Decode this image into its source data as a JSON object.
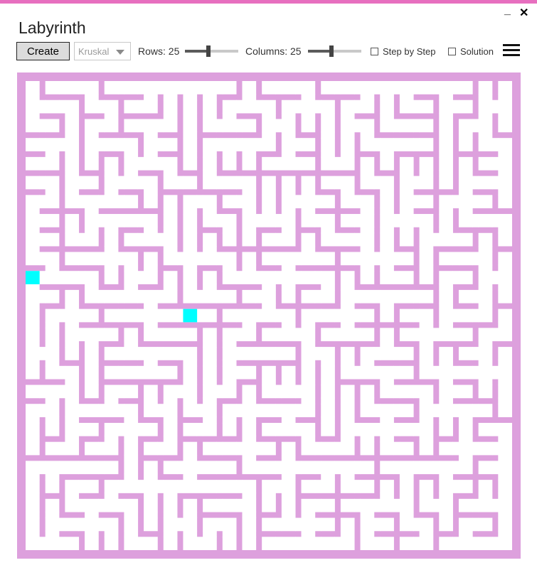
{
  "app": {
    "title": "Labyrinth",
    "minimize_glyph": "_",
    "close_glyph": "✕"
  },
  "toolbar": {
    "create_label": "Create",
    "algorithm": {
      "selected": "Kruskal"
    },
    "rows": {
      "label": "Rows: 25",
      "value": 25,
      "min": 5,
      "max": 50
    },
    "columns": {
      "label": "Columns: 25",
      "value": 25,
      "min": 5,
      "max": 50
    },
    "step_by_step": {
      "label": "Step by Step",
      "checked": false
    },
    "solution": {
      "label": "Solution",
      "checked": false
    },
    "menu_icon": "hamburger-menu-icon"
  },
  "maze": {
    "rows": 25,
    "columns": 25,
    "wall_color": "#dda0dd",
    "floor_color": "#ffffff",
    "marker_color": "#00ffff",
    "markers": [
      {
        "name": "start-marker",
        "row": 10,
        "col": 0
      },
      {
        "name": "goal-marker",
        "row": 12,
        "col": 8
      }
    ]
  },
  "colors": {
    "accent": "#e76fbf"
  }
}
